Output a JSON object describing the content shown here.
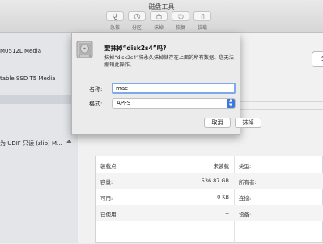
{
  "window": {
    "title": "磁盘工具"
  },
  "toolbar": {
    "items": [
      {
        "label": "急救",
        "icon": "stethoscope-icon"
      },
      {
        "label": "分区",
        "icon": "pie-icon"
      },
      {
        "label": "抹掉",
        "icon": "erase-icon"
      },
      {
        "label": "恢复",
        "icon": "restore-icon"
      },
      {
        "label": "装载",
        "icon": "mount-icon"
      }
    ]
  },
  "sidebar": {
    "items": [
      {
        "label": "M0512L Media"
      },
      {
        "label": "table SSD T5 Media"
      },
      {
        "label": "为 UDIF 只读 (zlib) M..."
      }
    ]
  },
  "main": {
    "right_button_label": "S"
  },
  "info_table": {
    "rows": [
      {
        "label": "装载点:",
        "value": "未装载",
        "right_label": "类型:"
      },
      {
        "label": "容量:",
        "value": "536.87 GB",
        "right_label": "所有者:"
      },
      {
        "label": "可用:",
        "value": "0 KB",
        "right_label": "连接:"
      },
      {
        "label": "已使用:",
        "value": "--",
        "right_label": "设备:"
      }
    ]
  },
  "dialog": {
    "title": "要抹掉“disk2s4”吗?",
    "description": "抹掉“disk2s4”将永久抹掉储存在上面的所有数据。您无法撤销此操作。",
    "name_label": "名称:",
    "name_value": "mac",
    "format_label": "格式:",
    "format_value": "APFS",
    "cancel_label": "取消",
    "erase_label": "抹掉"
  }
}
